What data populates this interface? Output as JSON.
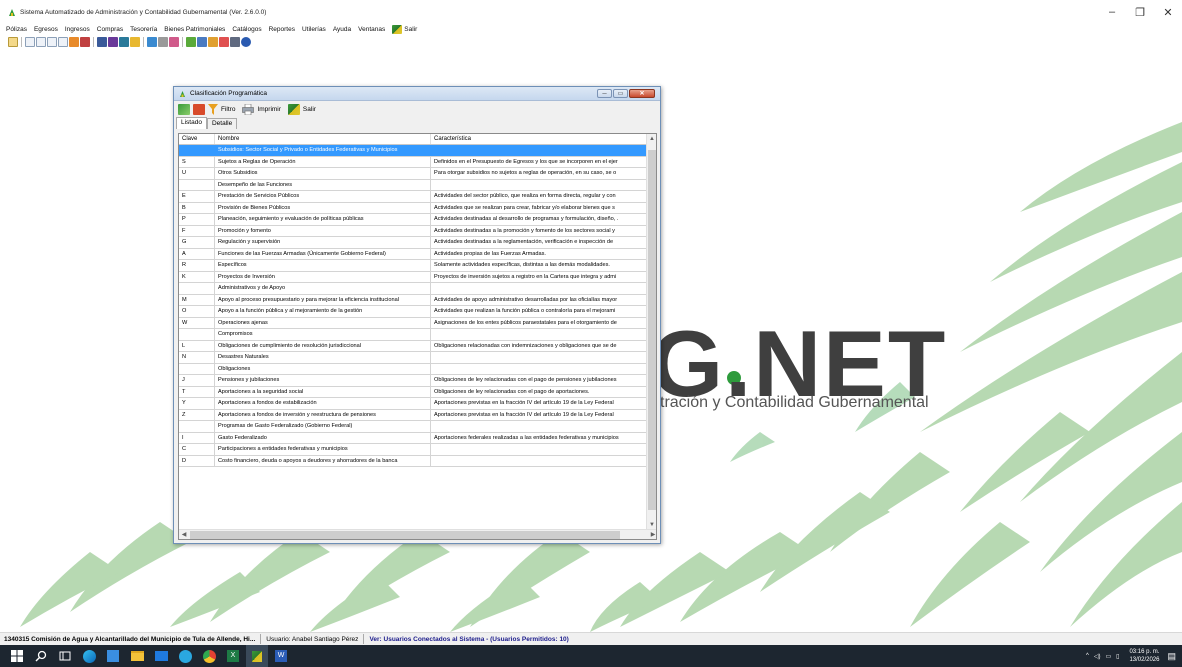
{
  "app": {
    "title": "Sistema Automatizado de Administración y Contabilidad Gubernamental  (Ver. 2.6.0.0)",
    "window_controls": {
      "minimize": "–",
      "maximize": "❐",
      "close": "✕"
    }
  },
  "menu": [
    "Pólizas",
    "Egresos",
    "Ingresos",
    "Compras",
    "Tesorería",
    "Bienes Patrimoniales",
    "Catálogos",
    "Reportes",
    "Utilerías",
    "Ayuda",
    "Ventanas"
  ],
  "menu_exit": "Salir",
  "background": {
    "brand": "G.NET",
    "subtitle": "stración y Contabilidad Gubernamental"
  },
  "window": {
    "title": "Clasificación Programática",
    "toolbar": {
      "filter": "Filtro",
      "print": "Imprimir",
      "exit": "Salir"
    },
    "tabs": [
      "Listado",
      "Detalle"
    ],
    "active_tab": "Listado",
    "columns": [
      "Clave",
      "Nombre",
      "Característica"
    ],
    "rows": [
      [
        "",
        "Subsidios: Sector Social y Privado o Entidades Federativas y Municipios",
        ""
      ],
      [
        "S",
        "Sujetos a Reglas de Operación",
        "Definidos en el Presupuesto de Egresos y los que se incorporen en el ejer"
      ],
      [
        "U",
        "Otros Subsidios",
        "Para otorgar subsidios no sujetos a reglas de operación, en su caso, se o"
      ],
      [
        "",
        "Desempeño de las Funciones",
        ""
      ],
      [
        "E",
        "Prestación de Servicios Públicos",
        "Actividades del sector público, que realiza en forma directa, regular y con"
      ],
      [
        "B",
        "Provisión de Bienes Públicos",
        "Actividades que se realizan para crear, fabricar y/o elaborar bienes que s"
      ],
      [
        "P",
        "Planeación, seguimiento y evaluación de políticas públicas",
        "Actividades destinadas al desarrollo de programas y formulación, diseño, ."
      ],
      [
        "F",
        "Promoción y fomento",
        "Actividades destinadas a la promoción y fomento de los sectores social y"
      ],
      [
        "G",
        "Regulación y supervisión",
        "Actividades destinadas a la reglamentación, verificación e inspección de"
      ],
      [
        "A",
        "Funciones de las Fuerzas Armadas (Únicamente Gobierno Federal)",
        "Actividades propias de las Fuerzas Armadas."
      ],
      [
        "R",
        "Específicos",
        "Solamente actividades específicas, distintas a las demás modalidades."
      ],
      [
        "K",
        "Proyectos de Inversión",
        "Proyectos de inversión sujetos a registro en la Cartera que integra y admi"
      ],
      [
        "",
        "Administrativos y de Apoyo",
        ""
      ],
      [
        "M",
        "Apoyo al proceso presupuestario y para mejorar la eficiencia institucional",
        "Actividades de apoyo administrativo desarrolladas por las oficialías mayor"
      ],
      [
        "O",
        "Apoyo a la función pública y al mejoramiento de la gestión",
        "Actividades que realizan la función pública o contraloría para el mejorami"
      ],
      [
        "W",
        "Operaciones ajenas",
        "Asignaciones de los entes públicos paraestatales para el otorgamiento de"
      ],
      [
        "",
        "Compromisos",
        ""
      ],
      [
        "L",
        "Obligaciones de cumplimiento de resolución jurisdiccional",
        "Obligaciones relacionadas con indemnizaciones y obligaciones que se de"
      ],
      [
        "N",
        "Desastres Naturales",
        ""
      ],
      [
        "",
        "Obligaciones",
        ""
      ],
      [
        "J",
        "Pensiones y jubilaciones",
        "Obligaciones de ley relacionadas con el pago de pensiones y jubilaciones"
      ],
      [
        "T",
        "Aportaciones a la seguridad social",
        "Obligaciones de ley relacionadas con el pago de aportaciones."
      ],
      [
        "Y",
        "Aportaciones a fondos de estabilización",
        "Aportaciones previstas en la fracción IV del artículo 19 de la Ley Federal"
      ],
      [
        "Z",
        "Aportaciones a fondos de inversión y reestructura de pensiones",
        "Aportaciones previstas en la fracción IV del artículo 19 de la Ley Federal"
      ],
      [
        "",
        "Programas de Gasto Federalizado (Gobierno Federal)",
        ""
      ],
      [
        "I",
        "Gasto Federalizado",
        "Aportaciones federales realizadas a las entidades federativas y municipios"
      ],
      [
        "C",
        "Participaciones a entidades federativas y municipios",
        ""
      ],
      [
        "D",
        "Costo financiero, deuda o apoyos a deudores y ahorradores de la banca",
        ""
      ]
    ]
  },
  "status": {
    "entity": "1340315 Comisión de Agua y Alcantarillado del Municipio de Tula de Allende, Hi...",
    "user": "Usuario: Anabel Santiago Pérez",
    "connected": "Ver: Usuarios Conectados al Sistema - (Usuarios Permitidos: 10)"
  },
  "taskbar": {
    "time": "03:16 p. m.",
    "date": "13/02/2026"
  },
  "colors": {
    "selection": "#3399ff",
    "taskbar": "#1d2630",
    "brand_green": "#2e9b3c"
  }
}
